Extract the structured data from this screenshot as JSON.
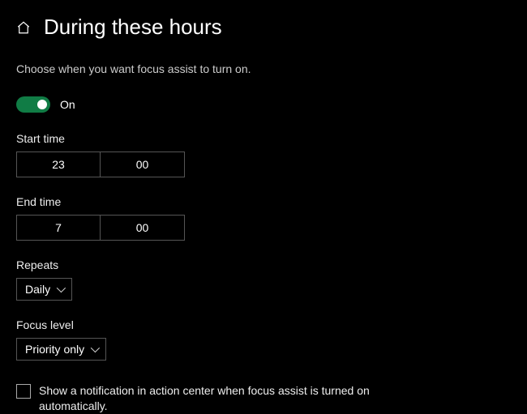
{
  "header": {
    "title": "During these hours"
  },
  "subtitle": "Choose when you want focus assist to turn on.",
  "toggle": {
    "state_label": "On"
  },
  "start": {
    "label": "Start time",
    "hour": "23",
    "minute": "00"
  },
  "end": {
    "label": "End time",
    "hour": "7",
    "minute": "00"
  },
  "repeats": {
    "label": "Repeats",
    "value": "Daily"
  },
  "focus_level": {
    "label": "Focus level",
    "value": "Priority only"
  },
  "notification_checkbox": {
    "label": "Show a notification in action center when focus assist is turned on automatically."
  }
}
